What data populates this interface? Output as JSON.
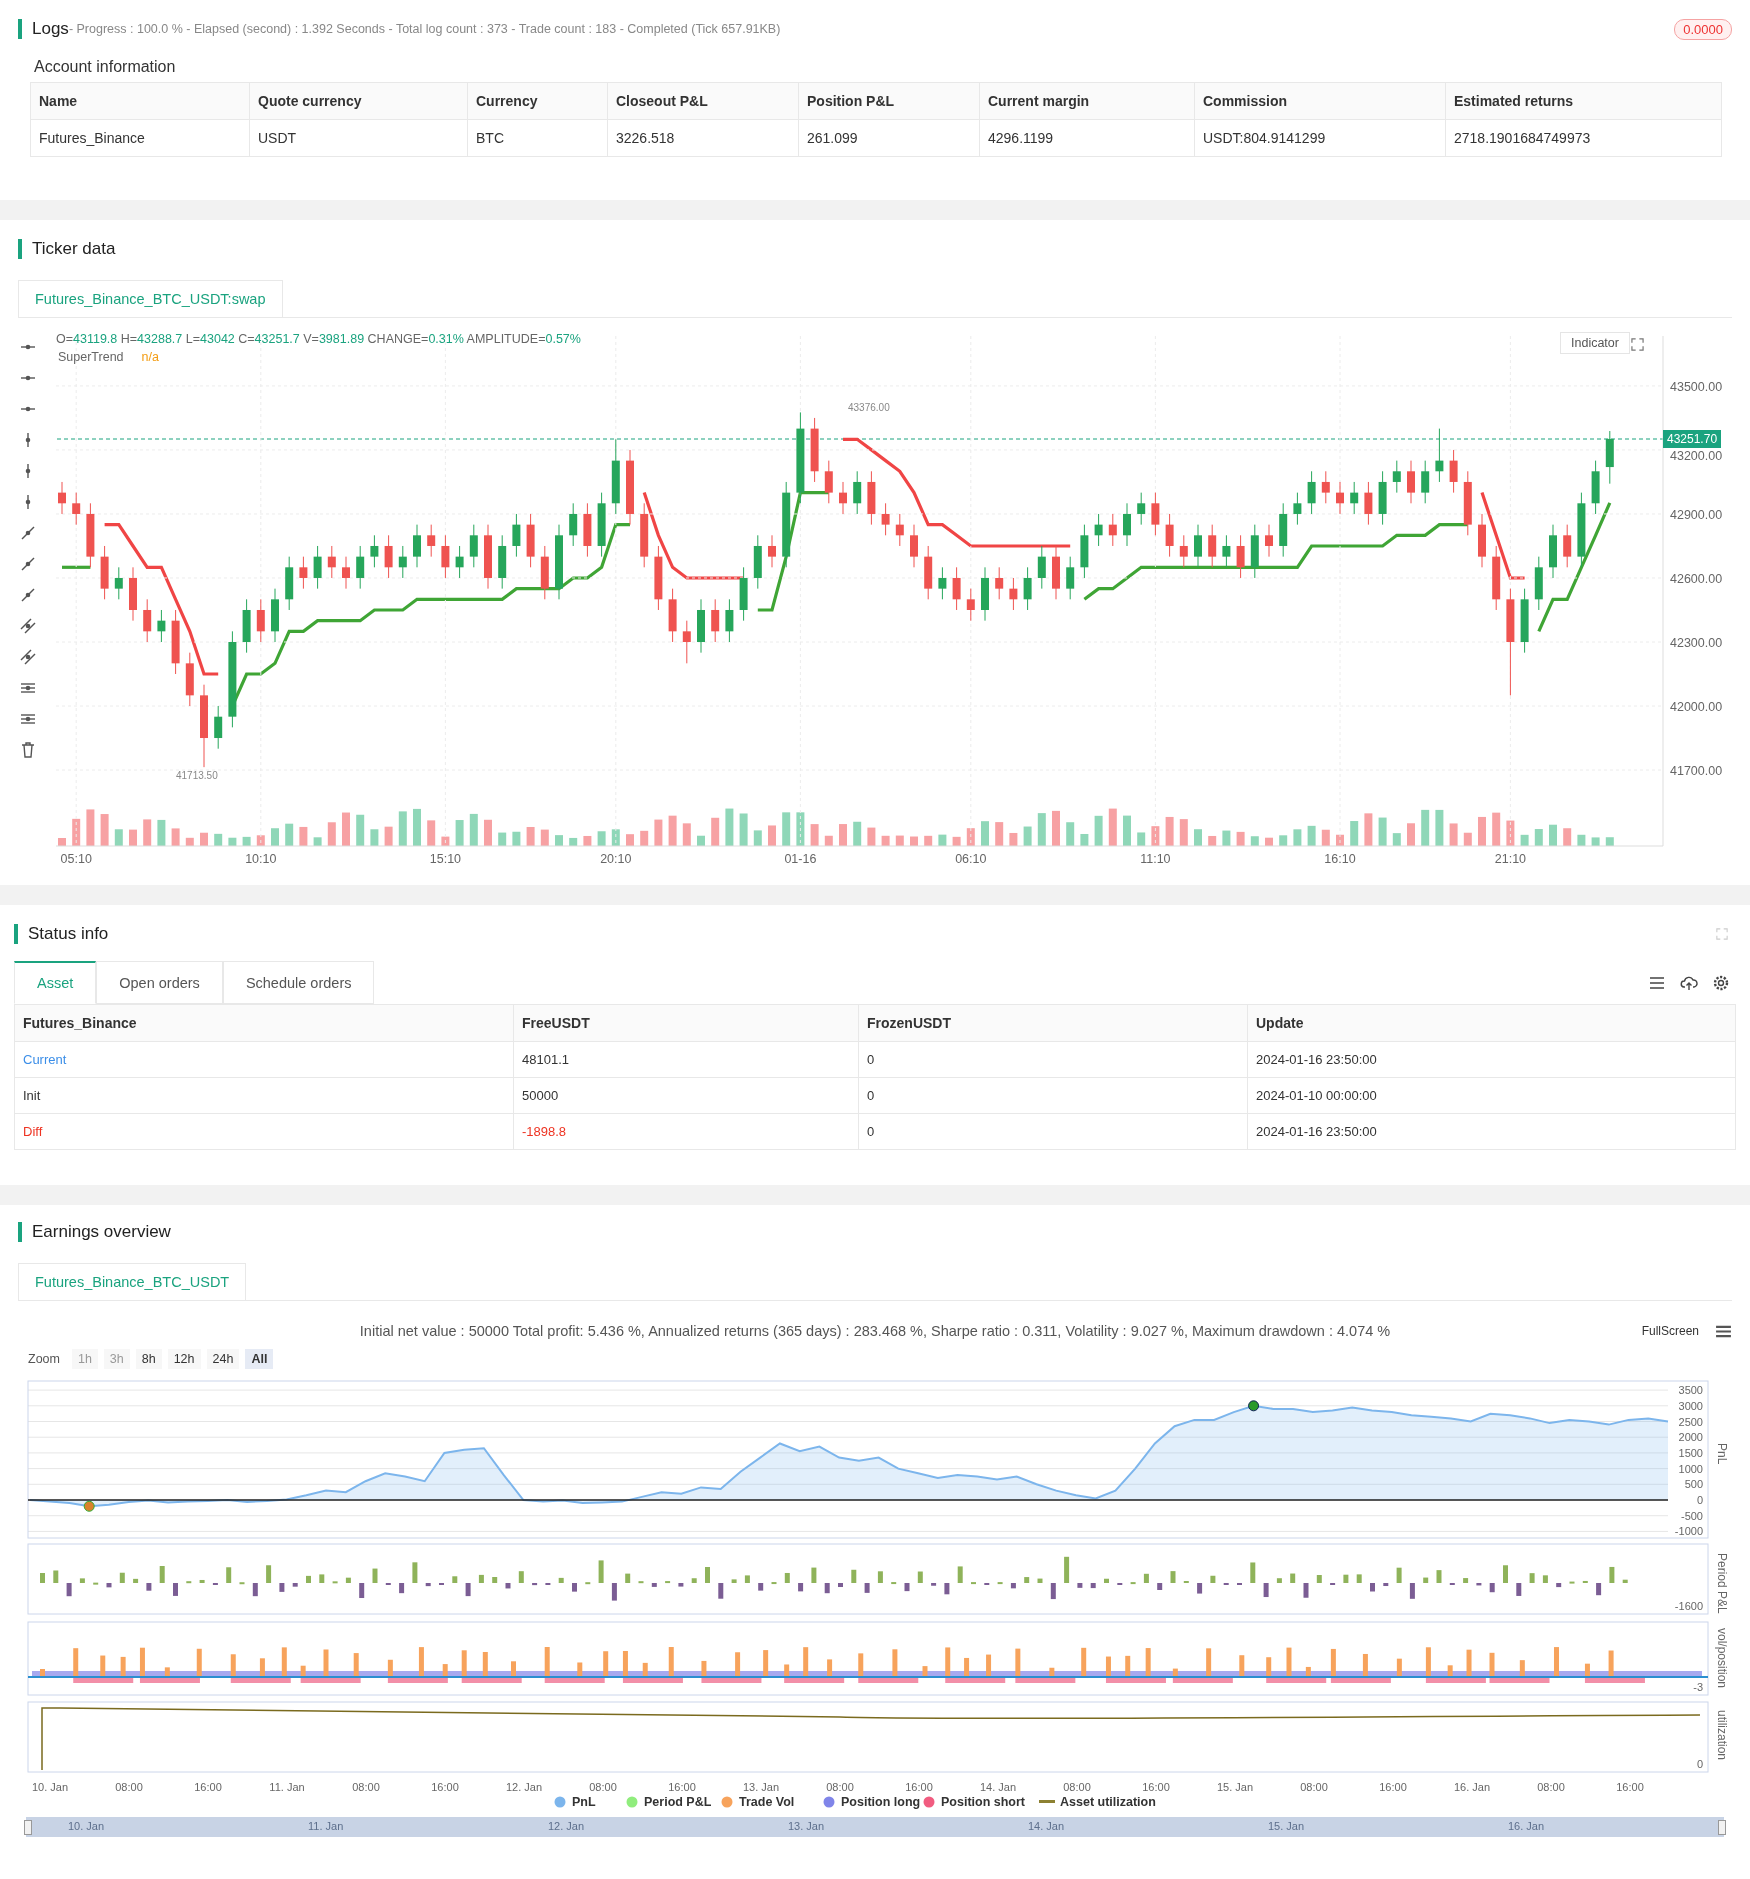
{
  "logs": {
    "title": "Logs",
    "summary": "- Progress : 100.0 % - Elapsed (second) : 1.392  Seconds - Total log count : 373 - Trade count : 183 - Completed (Tick 657.91KB)",
    "badge": "0.0000"
  },
  "account": {
    "title": "Account information",
    "columns": [
      "Name",
      "Quote currency",
      "Currency",
      "Closeout P&L",
      "Position P&L",
      "Current margin",
      "Commission",
      "Estimated returns"
    ],
    "rows": [
      [
        "Futures_Binance",
        "USDT",
        "BTC",
        "3226.518",
        "261.099",
        "4296.1199",
        "USDT:804.9141299",
        "2718.1901684749973"
      ]
    ]
  },
  "ticker": {
    "title": "Ticker data",
    "tabs": [
      {
        "label": "Futures_Binance_BTC_USDT:swap",
        "selected": true
      }
    ],
    "ohlc": [
      {
        "label": "O=",
        "value": "43119.8"
      },
      {
        "label": " H=",
        "value": "43288.7"
      },
      {
        "label": " L=",
        "value": "43042"
      },
      {
        "label": " C=",
        "value": "43251.7"
      },
      {
        "label": " V=",
        "value": "3981.89"
      },
      {
        "label": " CHANGE=",
        "value": "0.31%"
      },
      {
        "label": " AMPLITUDE=",
        "value": "0.57%"
      }
    ],
    "indicator": {
      "name": "SuperTrend",
      "value": "n/a"
    },
    "indicator_button": "Indicator",
    "current_price": "43251.70",
    "high_marker": "43376.00",
    "low_marker": "41713.50",
    "chart_data": {
      "type": "candlestick",
      "grid": true,
      "ylim": [
        41344,
        43734
      ],
      "yticks": [
        {
          "value": 43500,
          "label": "43500.00"
        },
        {
          "value": 43200,
          "label": "43200.00"
        },
        {
          "value": 42900,
          "label": "42900.00"
        },
        {
          "value": 42600,
          "label": "42600.00"
        },
        {
          "value": 42300,
          "label": "42300.00"
        },
        {
          "value": 42000,
          "label": "42000.00"
        },
        {
          "value": 41700,
          "label": "41700.00"
        }
      ],
      "categories": [
        null,
        "05:10",
        null,
        null,
        null,
        null,
        null,
        null,
        null,
        null,
        null,
        null,
        null,
        null,
        "10:10",
        null,
        null,
        null,
        null,
        null,
        null,
        null,
        null,
        null,
        null,
        null,
        null,
        "15:10",
        null,
        null,
        null,
        null,
        null,
        null,
        null,
        null,
        null,
        null,
        null,
        "20:10",
        null,
        null,
        null,
        null,
        null,
        null,
        null,
        null,
        null,
        null,
        null,
        null,
        "01-16",
        null,
        null,
        null,
        null,
        null,
        null,
        null,
        null,
        null,
        null,
        null,
        "06:10",
        null,
        null,
        null,
        null,
        null,
        null,
        null,
        null,
        null,
        null,
        null,
        null,
        "11:10",
        null,
        null,
        null,
        null,
        null,
        null,
        null,
        null,
        null,
        null,
        null,
        null,
        "16:10",
        null,
        null,
        null,
        null,
        null,
        null,
        null,
        null,
        null,
        null,
        null,
        "21:10",
        null,
        null,
        null,
        null,
        null,
        null,
        null
      ],
      "ohlc": [
        [
          43000,
          43050,
          42900,
          42950
        ],
        [
          42950,
          43000,
          42850,
          42900
        ],
        [
          42900,
          42950,
          42650,
          42700
        ],
        [
          42700,
          42750,
          42500,
          42550
        ],
        [
          42550,
          42650,
          42500,
          42600
        ],
        [
          42600,
          42650,
          42400,
          42450
        ],
        [
          42450,
          42500,
          42300,
          42350
        ],
        [
          42350,
          42450,
          42300,
          42400
        ],
        [
          42400,
          42450,
          42150,
          42200
        ],
        [
          42200,
          42250,
          42000,
          42050
        ],
        [
          42050,
          42100,
          41713.5,
          41850
        ],
        [
          41850,
          42000,
          41800,
          41950
        ],
        [
          41950,
          42350,
          41900,
          42300
        ],
        [
          42300,
          42500,
          42250,
          42450
        ],
        [
          42450,
          42500,
          42300,
          42350
        ],
        [
          42350,
          42550,
          42300,
          42500
        ],
        [
          42500,
          42700,
          42450,
          42650
        ],
        [
          42650,
          42700,
          42550,
          42600
        ],
        [
          42600,
          42750,
          42550,
          42700
        ],
        [
          42700,
          42750,
          42600,
          42650
        ],
        [
          42650,
          42700,
          42550,
          42600
        ],
        [
          42600,
          42750,
          42550,
          42700
        ],
        [
          42700,
          42800,
          42650,
          42750
        ],
        [
          42750,
          42800,
          42600,
          42650
        ],
        [
          42650,
          42750,
          42600,
          42700
        ],
        [
          42700,
          42850,
          42650,
          42800
        ],
        [
          42800,
          42850,
          42700,
          42750
        ],
        [
          42750,
          42800,
          42600,
          42650
        ],
        [
          42650,
          42750,
          42600,
          42700
        ],
        [
          42700,
          42850,
          42650,
          42800
        ],
        [
          42800,
          42850,
          42550,
          42600
        ],
        [
          42600,
          42800,
          42550,
          42750
        ],
        [
          42750,
          42900,
          42700,
          42850
        ],
        [
          42850,
          42900,
          42650,
          42700
        ],
        [
          42700,
          42750,
          42500,
          42550
        ],
        [
          42550,
          42850,
          42500,
          42800
        ],
        [
          42800,
          42950,
          42750,
          42900
        ],
        [
          42900,
          42950,
          42700,
          42750
        ],
        [
          42750,
          43000,
          42700,
          42950
        ],
        [
          42950,
          43250,
          42900,
          43150
        ],
        [
          43150,
          43200,
          42850,
          42900
        ],
        [
          42900,
          42950,
          42650,
          42700
        ],
        [
          42700,
          42750,
          42450,
          42500
        ],
        [
          42500,
          42550,
          42300,
          42350
        ],
        [
          42350,
          42400,
          42200,
          42300
        ],
        [
          42300,
          42500,
          42250,
          42450
        ],
        [
          42450,
          42500,
          42300,
          42350
        ],
        [
          42350,
          42500,
          42300,
          42450
        ],
        [
          42450,
          42650,
          42400,
          42600
        ],
        [
          42600,
          42800,
          42550,
          42750
        ],
        [
          42750,
          42800,
          42650,
          42700
        ],
        [
          42700,
          43050,
          42650,
          43000
        ],
        [
          43000,
          43376,
          42950,
          43300
        ],
        [
          43300,
          43350,
          43050,
          43100
        ],
        [
          43100,
          43150,
          42950,
          43000
        ],
        [
          43000,
          43050,
          42900,
          42950
        ],
        [
          42950,
          43100,
          42900,
          43050
        ],
        [
          43050,
          43100,
          42850,
          42900
        ],
        [
          42900,
          42950,
          42800,
          42850
        ],
        [
          42850,
          42900,
          42750,
          42800
        ],
        [
          42800,
          42850,
          42650,
          42700
        ],
        [
          42700,
          42750,
          42500,
          42550
        ],
        [
          42550,
          42650,
          42500,
          42600
        ],
        [
          42600,
          42650,
          42450,
          42500
        ],
        [
          42500,
          42550,
          42400,
          42450
        ],
        [
          42450,
          42650,
          42400,
          42600
        ],
        [
          42600,
          42650,
          42500,
          42550
        ],
        [
          42550,
          42600,
          42450,
          42500
        ],
        [
          42500,
          42650,
          42450,
          42600
        ],
        [
          42600,
          42750,
          42550,
          42700
        ],
        [
          42700,
          42750,
          42500,
          42550
        ],
        [
          42550,
          42700,
          42500,
          42650
        ],
        [
          42650,
          42850,
          42600,
          42800
        ],
        [
          42800,
          42900,
          42750,
          42850
        ],
        [
          42850,
          42900,
          42750,
          42800
        ],
        [
          42800,
          42950,
          42750,
          42900
        ],
        [
          42900,
          43000,
          42850,
          42950
        ],
        [
          42950,
          43000,
          42800,
          42850
        ],
        [
          42850,
          42900,
          42700,
          42750
        ],
        [
          42750,
          42800,
          42650,
          42700
        ],
        [
          42700,
          42850,
          42650,
          42800
        ],
        [
          42800,
          42850,
          42650,
          42700
        ],
        [
          42700,
          42800,
          42650,
          42750
        ],
        [
          42750,
          42800,
          42600,
          42650
        ],
        [
          42650,
          42850,
          42600,
          42800
        ],
        [
          42800,
          42850,
          42700,
          42750
        ],
        [
          42750,
          42950,
          42700,
          42900
        ],
        [
          42900,
          43000,
          42850,
          42950
        ],
        [
          42950,
          43100,
          42900,
          43050
        ],
        [
          43050,
          43100,
          42950,
          43000
        ],
        [
          43000,
          43050,
          42900,
          42950
        ],
        [
          42950,
          43050,
          42900,
          43000
        ],
        [
          43000,
          43050,
          42850,
          42900
        ],
        [
          42900,
          43100,
          42850,
          43050
        ],
        [
          43050,
          43150,
          43000,
          43100
        ],
        [
          43100,
          43150,
          42950,
          43000
        ],
        [
          43000,
          43150,
          42950,
          43100
        ],
        [
          43100,
          43300,
          43050,
          43150
        ],
        [
          43150,
          43200,
          43000,
          43050
        ],
        [
          43050,
          43100,
          42800,
          42850
        ],
        [
          42850,
          42900,
          42650,
          42700
        ],
        [
          42700,
          42750,
          42450,
          42500
        ],
        [
          42500,
          42550,
          42050,
          42300
        ],
        [
          42300,
          42550,
          42250,
          42500
        ],
        [
          42500,
          42700,
          42450,
          42650
        ],
        [
          42650,
          42850,
          42600,
          42800
        ],
        [
          42800,
          42850,
          42650,
          42700
        ],
        [
          42700,
          43000,
          42650,
          42950
        ],
        [
          42950,
          43150,
          42900,
          43100
        ],
        [
          43119.8,
          43288.7,
          43042,
          43251.7
        ]
      ]
    }
  },
  "status": {
    "title": "Status info",
    "tabs": [
      {
        "label": "Asset",
        "selected": true
      },
      {
        "label": "Open orders",
        "selected": false
      },
      {
        "label": "Schedule orders",
        "selected": false
      }
    ],
    "columns": [
      "Futures_Binance",
      "FreeUSDT",
      "FrozenUSDT",
      "Update"
    ],
    "rows": [
      {
        "kind": "current",
        "cells": [
          "Current",
          "48101.1",
          "0",
          "2024-01-16 23:50:00"
        ]
      },
      {
        "kind": "init",
        "cells": [
          "Init",
          "50000",
          "0",
          "2024-01-10 00:00:00"
        ]
      },
      {
        "kind": "diff",
        "cells": [
          "Diff",
          "-1898.8",
          "0",
          "2024-01-16 23:50:00"
        ]
      }
    ]
  },
  "earnings": {
    "title": "Earnings overview",
    "tabs": [
      {
        "label": "Futures_Binance_BTC_USDT",
        "selected": true
      }
    ],
    "summary": "Initial net value : 50000 Total profit: 5.436 %, Annualized returns (365 days) : 283.468 %, Sharpe ratio : 0.311, Volatility : 9.027 %, Maximum drawdown : 4.074 %",
    "fullscreen": "FullScreen",
    "zoom_label": "Zoom",
    "zoom": [
      {
        "label": "1h",
        "disabled": true,
        "selected": false
      },
      {
        "label": "3h",
        "disabled": true,
        "selected": false
      },
      {
        "label": "8h",
        "disabled": false,
        "selected": false
      },
      {
        "label": "12h",
        "disabled": false,
        "selected": false
      },
      {
        "label": "24h",
        "disabled": false,
        "selected": false
      },
      {
        "label": "All",
        "disabled": false,
        "selected": true
      }
    ],
    "chart_data": {
      "type": "area",
      "ylabel": "PnL",
      "grid": true,
      "ylim": [
        -1210,
        3790
      ],
      "yticks": [
        3500,
        3000,
        2500,
        2000,
        1500,
        1000,
        500,
        0,
        -500,
        -1000
      ],
      "series": [
        {
          "name": "PnL",
          "color": "#7cb5ec",
          "values": [
            0,
            -50,
            -100,
            -200,
            -150,
            -60,
            -20,
            -80,
            -50,
            -30,
            0,
            -60,
            -30,
            20,
            150,
            300,
            250,
            600,
            850,
            750,
            600,
            1500,
            1600,
            1650,
            800,
            0,
            -50,
            -20,
            -100,
            -80,
            -50,
            100,
            250,
            200,
            400,
            350,
            900,
            1350,
            1800,
            1550,
            1700,
            1350,
            1250,
            1350,
            1000,
            850,
            700,
            800,
            750,
            650,
            750,
            500,
            300,
            150,
            50,
            300,
            1000,
            1800,
            2350,
            2550,
            2550,
            2800,
            3000,
            2900,
            2900,
            2800,
            2850,
            2950,
            2850,
            2800,
            2700,
            2650,
            2600,
            2500,
            2750,
            2700,
            2600,
            2450,
            2550,
            2500,
            2400,
            2550,
            2600,
            2500
          ]
        }
      ]
    },
    "pane_titles": [
      "Period P&L",
      "vol/position",
      "utilization"
    ],
    "period_tick": "-1600",
    "vol_tick": "-3",
    "util_tick": "0",
    "time_ticks": [
      "10. Jan",
      "08:00",
      "16:00",
      "11. Jan",
      "08:00",
      "16:00",
      "12. Jan",
      "08:00",
      "16:00",
      "13. Jan",
      "08:00",
      "16:00",
      "14. Jan",
      "08:00",
      "16:00",
      "15. Jan",
      "08:00",
      "16:00",
      "16. Jan",
      "08:00",
      "16:00"
    ],
    "legend": [
      {
        "label": "Period P&L",
        "color": "#90ed7d",
        "kind": "dot"
      },
      {
        "label": "Trade Vol",
        "color": "#f7a35c",
        "kind": "dot"
      },
      {
        "label": "Position long",
        "color": "#8085e9",
        "kind": "dot"
      },
      {
        "label": "Position short",
        "color": "#f15c80",
        "kind": "dot"
      },
      {
        "label": "Asset utilization",
        "color": "#8d8132",
        "kind": "line"
      }
    ],
    "navigator_ticks": [
      "10. Jan",
      "11. Jan",
      "12. Jan",
      "13. Jan",
      "14. Jan",
      "15. Jan",
      "16. Jan"
    ]
  }
}
